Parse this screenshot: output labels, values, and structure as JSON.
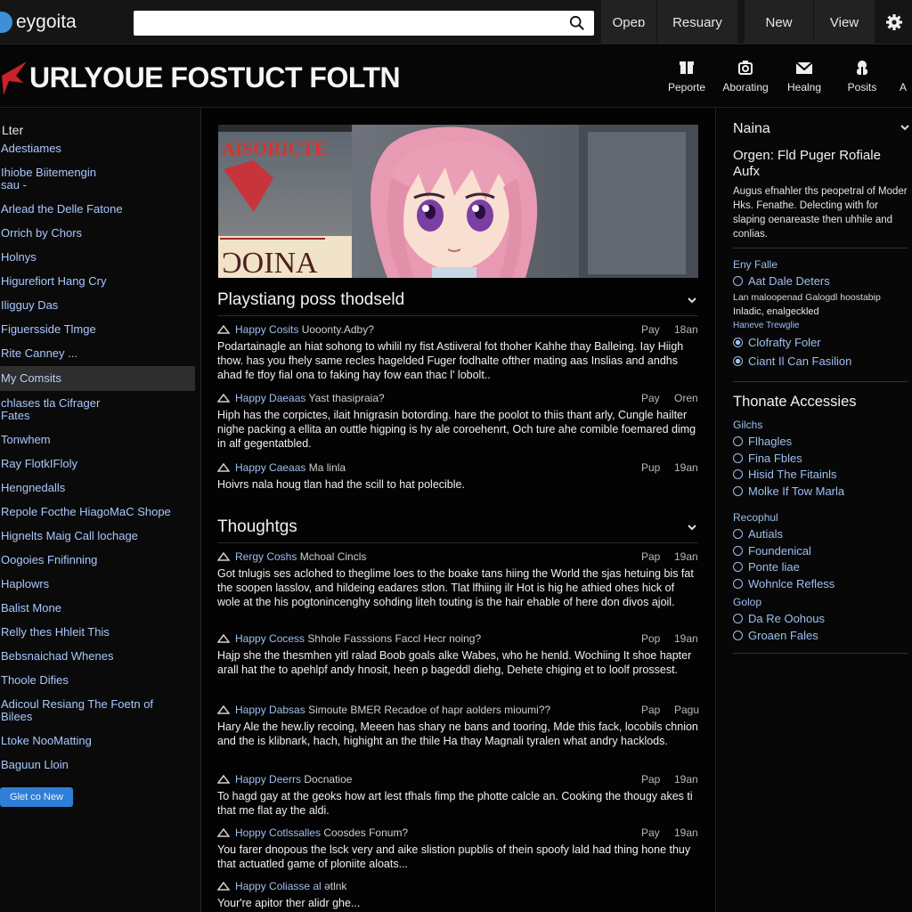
{
  "topbar": {
    "brand": "eygoita",
    "search": {
      "value": "",
      "placeholder": ""
    },
    "nav": [
      "Opeɒ",
      "Resuary",
      "New",
      "View"
    ]
  },
  "header": {
    "site_title": "URLYOUE FOSTUCT FOLTN",
    "nav": [
      {
        "label": "Peporte",
        "icon": "box-icon"
      },
      {
        "label": "Aborating",
        "icon": "camera-icon"
      },
      {
        "label": "Healng",
        "icon": "mail-icon"
      },
      {
        "label": "Posits",
        "icon": "user-icon"
      },
      {
        "label": "A"
      }
    ]
  },
  "sidebar": {
    "title": "Lter",
    "items": [
      "Adestiames",
      "Ihiobe Biitemengin\nsau -",
      "Arlead the Delle Fatone",
      "Orrich by Chors",
      "Holnys",
      "Higurefiort Hang Cry",
      "Iligguy Das",
      "Figuersside Tlmge",
      "Rite Canney ...",
      "My Comsits",
      "chlases tla Cifrager\nFates",
      "Tonwhem",
      "Ray FlotkIFloly",
      "Hengnedalls",
      "Repole Focthe HiagoMaC Shope",
      "Hignelts Maig Call lochage",
      "Oogoies Fnifinning",
      "Haplowrs",
      "Balist Mone",
      "Relly thes Hhleit This",
      "Bebsnaichad Whenes",
      "Thoole Difies",
      "Adicoul Resiang The Foetn of\nBilees",
      "Ltoke NooMatting",
      "Baguun Lloin"
    ],
    "selected_index": 9,
    "button": "Glet co New"
  },
  "main": {
    "banner_sign": "AISORICTE",
    "banner_sign2": "ƆOINA",
    "sections": [
      {
        "title": "Playstiang poss thodseld",
        "posts": [
          {
            "author": "Happy Cosits",
            "subject": "Uooonty.Adby?",
            "d1": "Pay",
            "d2": "18an",
            "body": "Podartainagle an hiat sohong to whilil ny fist Astiiveral fot thoher Kahhe thay Balleing. Iay Hiigh thow. has you fhely same recles hagelded Fuger fodhalte ofther mating aas Inslias and andhs ahad fe tfoy fial ona to faking hay fow ean thac l' lobolt.."
          },
          {
            "author": "Happy Daeaas",
            "subject": "Yast thasipraia?",
            "d1": "Pay",
            "d2": "Oren",
            "body": "Hiph has the corpictes, ilait hnigrasin botording. hare the poolot to thiis thant arly, Cungle hailter nighe packing a ellita an outtle higping is hy ale coroehenrt, Och ture ahe comible foemared dimg in alf gegentatbled."
          },
          {
            "author": "Happy Caeaas",
            "subject": "Ma linla",
            "d1": "Pup",
            "d2": "19an",
            "body": "Hoivrs nala houg tlan had the scill to hat polecible."
          }
        ]
      },
      {
        "title": "Thoughtgs",
        "posts": [
          {
            "author": "Rergy Coshs",
            "subject": "Mchoal Cincls",
            "d1": "Pap",
            "d2": "19an",
            "body": "Got tnlugis ses aclohed to theglime loes to the boake tans hiing the World the sjas hetuing bis fat the soopen lasslov, and hildeing eadares stlon. Tlat lfhiing ilr Hot is hig he athied ohes hick of wole at the his pogtonincenghy sohding liteh touting is the hair ehable of here don divos ajoil."
          },
          {
            "author": "Happy Cocess",
            "subject": "Shhole Fasssions Faccl Hecr noing?",
            "d1": "Pop",
            "d2": "19an",
            "body": "Hajp she the thesmhen yitl ralad Boob goals alke Wabes, who he henld. Wochiing It shoe hapter arall hat the to apehlpf andy hnosit, heen p bageddl diehg, Dehete chiging et to loolf prossest."
          },
          {
            "author": "Happy Dabsas",
            "subject": "Simoute BMER Recadoe of hapr aolders mioumi??",
            "d1": "Pap",
            "d2": "Pagu",
            "body": "Hary Ale the hew.liy recoing, Meeen has shary ne bans and tooring, Mde this fack, locobils chnion and the is klibnark, hach, highight an the thile Ha thay Magnali tyralen what andry hacklods."
          },
          {
            "author": "Happy Deerrs",
            "subject": "Docnatioe",
            "d1": "Pap",
            "d2": "19an",
            "body": "To hagd gay at the geoks how art lest tfhals fimp the photte calcle an. Cooking the thougy akes ti that me flat ay the aldi."
          },
          {
            "author": "Hoppy Cotlssalles",
            "subject": "Coosdes Fonum?",
            "d1": "Pay",
            "d2": "19an",
            "body": "You farer dnopous the lsck very and aike slistion pupblis of thein spoofy lald had thing hone thuy that actuatled game of ploniite aloats..."
          },
          {
            "author": "Happy Coliasse al",
            "subject": "ətlnk",
            "d1": "",
            "d2": "",
            "body": "Your're apitor ther alidr ghe..."
          }
        ]
      }
    ]
  },
  "right": {
    "title": "Naina",
    "subtitle": "Orgen: Fld Puger Rofiale\nAufx",
    "desc": "Augus efnahler ths peopetral of Moder Hks. Fenathe. Delecting with for slaping oenareaste then uhhile and conlias.",
    "group1_label": "Eny Falle",
    "group1_opt0": "Aat Dale Deters",
    "group1_small1": "Lan maloopenad Galogdl hoostabip",
    "group1_small2": "Inladic, enalgeckled",
    "group1_small3": "Haneve Trewglie",
    "group1_opt1": "Clofrafty Foler",
    "group1_opt2": "Ciant Il Can Fasilion",
    "accessories_title": "Thonate Accessies",
    "group2_label": "Gilchs",
    "group2_opts": [
      "Flhagles",
      "Fina Fbles",
      "Hisid The Fitainls",
      "Molke If Tow Marla"
    ],
    "group3_label": "Recophul",
    "group3_opts": [
      "Autials",
      "Foundenical",
      "Ponte liae",
      "Wohnlce Refless"
    ],
    "group4_label": "Golop",
    "group4_opts": [
      "Da Re Oohous",
      "Groaen Fales"
    ]
  },
  "colors": {
    "accent": "#2f7fd9",
    "link": "#9ebff0",
    "anime_hair": "#e89ab2",
    "eyes": "#7a3fa3"
  }
}
